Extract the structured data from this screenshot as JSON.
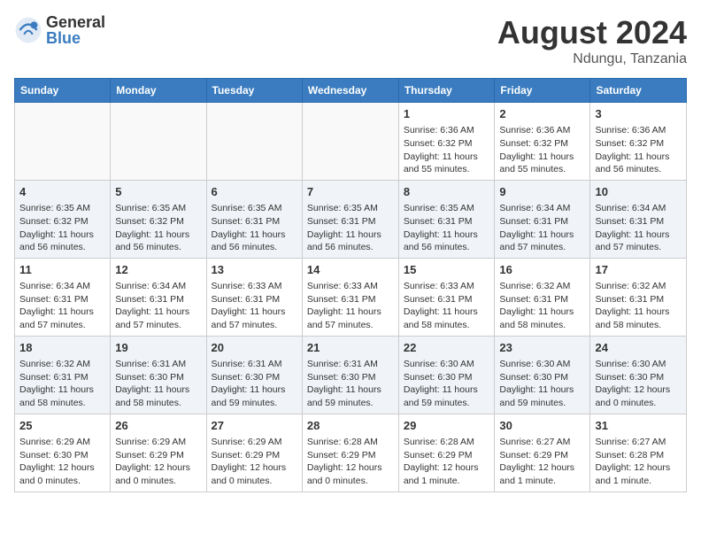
{
  "header": {
    "logo_general": "General",
    "logo_blue": "Blue",
    "month_year": "August 2024",
    "location": "Ndungu, Tanzania"
  },
  "weekdays": [
    "Sunday",
    "Monday",
    "Tuesday",
    "Wednesday",
    "Thursday",
    "Friday",
    "Saturday"
  ],
  "weeks": [
    [
      {
        "day": "",
        "info": ""
      },
      {
        "day": "",
        "info": ""
      },
      {
        "day": "",
        "info": ""
      },
      {
        "day": "",
        "info": ""
      },
      {
        "day": "1",
        "info": "Sunrise: 6:36 AM\nSunset: 6:32 PM\nDaylight: 11 hours\nand 55 minutes."
      },
      {
        "day": "2",
        "info": "Sunrise: 6:36 AM\nSunset: 6:32 PM\nDaylight: 11 hours\nand 55 minutes."
      },
      {
        "day": "3",
        "info": "Sunrise: 6:36 AM\nSunset: 6:32 PM\nDaylight: 11 hours\nand 56 minutes."
      }
    ],
    [
      {
        "day": "4",
        "info": "Sunrise: 6:35 AM\nSunset: 6:32 PM\nDaylight: 11 hours\nand 56 minutes."
      },
      {
        "day": "5",
        "info": "Sunrise: 6:35 AM\nSunset: 6:32 PM\nDaylight: 11 hours\nand 56 minutes."
      },
      {
        "day": "6",
        "info": "Sunrise: 6:35 AM\nSunset: 6:31 PM\nDaylight: 11 hours\nand 56 minutes."
      },
      {
        "day": "7",
        "info": "Sunrise: 6:35 AM\nSunset: 6:31 PM\nDaylight: 11 hours\nand 56 minutes."
      },
      {
        "day": "8",
        "info": "Sunrise: 6:35 AM\nSunset: 6:31 PM\nDaylight: 11 hours\nand 56 minutes."
      },
      {
        "day": "9",
        "info": "Sunrise: 6:34 AM\nSunset: 6:31 PM\nDaylight: 11 hours\nand 57 minutes."
      },
      {
        "day": "10",
        "info": "Sunrise: 6:34 AM\nSunset: 6:31 PM\nDaylight: 11 hours\nand 57 minutes."
      }
    ],
    [
      {
        "day": "11",
        "info": "Sunrise: 6:34 AM\nSunset: 6:31 PM\nDaylight: 11 hours\nand 57 minutes."
      },
      {
        "day": "12",
        "info": "Sunrise: 6:34 AM\nSunset: 6:31 PM\nDaylight: 11 hours\nand 57 minutes."
      },
      {
        "day": "13",
        "info": "Sunrise: 6:33 AM\nSunset: 6:31 PM\nDaylight: 11 hours\nand 57 minutes."
      },
      {
        "day": "14",
        "info": "Sunrise: 6:33 AM\nSunset: 6:31 PM\nDaylight: 11 hours\nand 57 minutes."
      },
      {
        "day": "15",
        "info": "Sunrise: 6:33 AM\nSunset: 6:31 PM\nDaylight: 11 hours\nand 58 minutes."
      },
      {
        "day": "16",
        "info": "Sunrise: 6:32 AM\nSunset: 6:31 PM\nDaylight: 11 hours\nand 58 minutes."
      },
      {
        "day": "17",
        "info": "Sunrise: 6:32 AM\nSunset: 6:31 PM\nDaylight: 11 hours\nand 58 minutes."
      }
    ],
    [
      {
        "day": "18",
        "info": "Sunrise: 6:32 AM\nSunset: 6:31 PM\nDaylight: 11 hours\nand 58 minutes."
      },
      {
        "day": "19",
        "info": "Sunrise: 6:31 AM\nSunset: 6:30 PM\nDaylight: 11 hours\nand 58 minutes."
      },
      {
        "day": "20",
        "info": "Sunrise: 6:31 AM\nSunset: 6:30 PM\nDaylight: 11 hours\nand 59 minutes."
      },
      {
        "day": "21",
        "info": "Sunrise: 6:31 AM\nSunset: 6:30 PM\nDaylight: 11 hours\nand 59 minutes."
      },
      {
        "day": "22",
        "info": "Sunrise: 6:30 AM\nSunset: 6:30 PM\nDaylight: 11 hours\nand 59 minutes."
      },
      {
        "day": "23",
        "info": "Sunrise: 6:30 AM\nSunset: 6:30 PM\nDaylight: 11 hours\nand 59 minutes."
      },
      {
        "day": "24",
        "info": "Sunrise: 6:30 AM\nSunset: 6:30 PM\nDaylight: 12 hours\nand 0 minutes."
      }
    ],
    [
      {
        "day": "25",
        "info": "Sunrise: 6:29 AM\nSunset: 6:30 PM\nDaylight: 12 hours\nand 0 minutes."
      },
      {
        "day": "26",
        "info": "Sunrise: 6:29 AM\nSunset: 6:29 PM\nDaylight: 12 hours\nand 0 minutes."
      },
      {
        "day": "27",
        "info": "Sunrise: 6:29 AM\nSunset: 6:29 PM\nDaylight: 12 hours\nand 0 minutes."
      },
      {
        "day": "28",
        "info": "Sunrise: 6:28 AM\nSunset: 6:29 PM\nDaylight: 12 hours\nand 0 minutes."
      },
      {
        "day": "29",
        "info": "Sunrise: 6:28 AM\nSunset: 6:29 PM\nDaylight: 12 hours\nand 1 minute."
      },
      {
        "day": "30",
        "info": "Sunrise: 6:27 AM\nSunset: 6:29 PM\nDaylight: 12 hours\nand 1 minute."
      },
      {
        "day": "31",
        "info": "Sunrise: 6:27 AM\nSunset: 6:28 PM\nDaylight: 12 hours\nand 1 minute."
      }
    ]
  ]
}
